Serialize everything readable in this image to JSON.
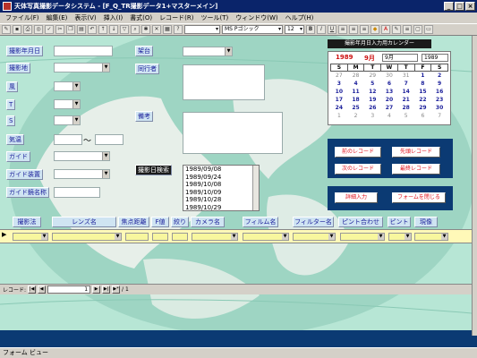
{
  "window": {
    "title": "天体写真撮影データシステム - [F_Q_TR撮影データ1+マスターメイン]",
    "controls": [
      "_",
      "□",
      "×"
    ]
  },
  "menu": [
    "ファイル(F)",
    "編集(E)",
    "表示(V)",
    "挿入(I)",
    "書式(O)",
    "レコード(R)",
    "ツール(T)",
    "ウィンドウ(W)",
    "ヘルプ(H)"
  ],
  "toolbar": {
    "font_name": "MS Pゴシック",
    "font_size": "12"
  },
  "form": {
    "labels": {
      "date": "撮影年月日",
      "place": "撮影地",
      "wind": "風",
      "t": "T",
      "s": "S",
      "temp": "気温",
      "guide": "ガイド",
      "guide_device": "ガイド装置",
      "guide_scope": "ガイド鏡名称",
      "mount": "架台",
      "companion": "同行者",
      "notes": "備考",
      "date_search": "撮影日検索"
    },
    "temp_separator": "〜",
    "date_list": [
      "1989/09/08",
      "1989/09/24",
      "1989/10/08",
      "1989/10/09",
      "1989/10/28",
      "1989/10/29"
    ]
  },
  "calendar": {
    "title": "撮影年月日入力用カレンダー",
    "year": "1989",
    "month": "9月",
    "month_select": "9月",
    "year_select": "1989",
    "weekdays": [
      "S",
      "M",
      "T",
      "W",
      "T",
      "F",
      "S"
    ],
    "weeks": [
      [
        "27",
        "28",
        "29",
        "30",
        "31",
        "1",
        "2"
      ],
      [
        "3",
        "4",
        "5",
        "6",
        "7",
        "8",
        "9"
      ],
      [
        "10",
        "11",
        "12",
        "13",
        "14",
        "15",
        "16"
      ],
      [
        "17",
        "18",
        "19",
        "20",
        "21",
        "22",
        "23"
      ],
      [
        "24",
        "25",
        "26",
        "27",
        "28",
        "29",
        "30"
      ],
      [
        "1",
        "2",
        "3",
        "4",
        "5",
        "6",
        "7"
      ]
    ]
  },
  "buttons": {
    "prev_record": "前のレコード",
    "first_record": "先頭レコード",
    "next_record": "次のレコード",
    "last_record": "最終レコード",
    "detail_input": "詳細入力",
    "close_form": "フォームを閉じる"
  },
  "grid": {
    "headers": [
      "撮影法",
      "レンズ名",
      "焦点距離",
      "F値",
      "絞り",
      "カメラ名",
      "フィルム名",
      "フィルター名",
      "ピント合わせ",
      "ピント",
      "現像"
    ]
  },
  "navigation": {
    "label": "レコード:",
    "current": "1",
    "total": "/ 1"
  },
  "status": {
    "text": "フォーム ビュー"
  }
}
